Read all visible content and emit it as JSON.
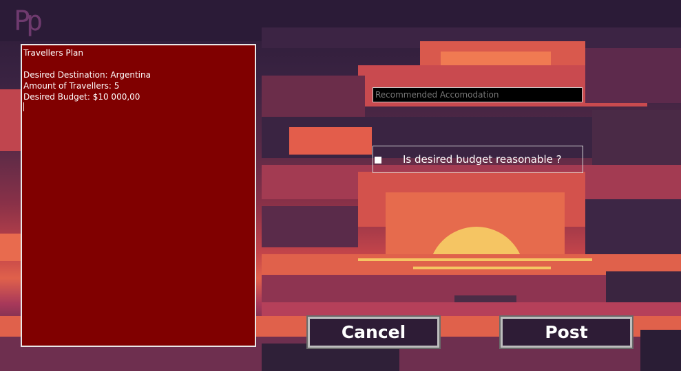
{
  "logo": {
    "text": "Pp"
  },
  "plan": {
    "lines": [
      "Travellers Plan",
      "",
      "Desired Destination: Argentina",
      "Amount of Travellers: 5",
      "Desired Budget: $10 000,00"
    ]
  },
  "accommodation": {
    "placeholder": "Recommended Accomodation",
    "value": ""
  },
  "budget_check": {
    "label": "Is desired budget reasonable ?",
    "checked": false
  },
  "buttons": {
    "cancel": "Cancel",
    "post": "Post"
  },
  "colors": {
    "plan_bg": "#800000",
    "sun": "#f5c563",
    "button_bg": "#2e1c36"
  }
}
